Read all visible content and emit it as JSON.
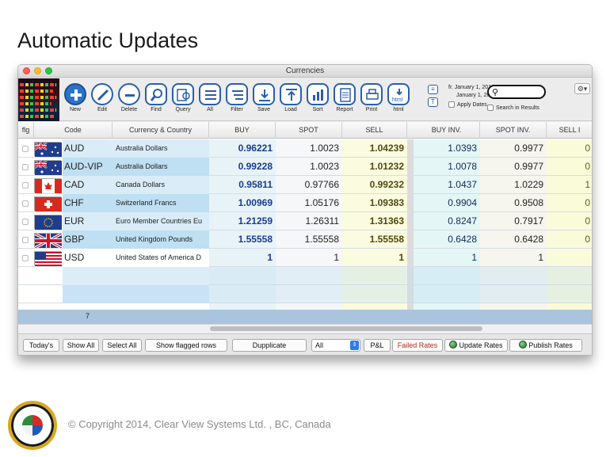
{
  "slide": {
    "title": "Automatic Updates",
    "copyright": "© Copyright 2014, Clear View Systems Ltd. , BC, Canada"
  },
  "window": {
    "title": "Currencies"
  },
  "toolbar": {
    "buttons": [
      {
        "label": "New",
        "icon": "plus-icon"
      },
      {
        "label": "Edit",
        "icon": "pencil-icon"
      },
      {
        "label": "Delete",
        "icon": "minus-icon"
      },
      {
        "label": "Find",
        "icon": "magnifier-icon"
      },
      {
        "label": "Query",
        "icon": "query-icon"
      },
      {
        "label": "All",
        "icon": "list-icon"
      },
      {
        "label": "Filter",
        "icon": "filter-list-icon"
      },
      {
        "label": "Save",
        "icon": "save-icon"
      },
      {
        "label": "Load",
        "icon": "load-icon"
      },
      {
        "label": "Sort",
        "icon": "sort-icon"
      },
      {
        "label": "Report",
        "icon": "report-icon"
      },
      {
        "label": "Print",
        "icon": "printer-icon"
      },
      {
        "label": "html",
        "icon": "html-export-icon"
      }
    ],
    "date_from": "fr.  January 1, 2012",
    "date_to": "January 1, 2013",
    "apply_dates": "Apply Dates",
    "search_in_results": "Search in Results",
    "search_placeholder": ""
  },
  "table": {
    "headers": [
      "flg",
      "Code",
      "Currency & Country",
      "BUY",
      "SPOT",
      "SELL",
      "BUY INV.",
      "SPOT INV.",
      "SELL I"
    ],
    "rows": [
      {
        "code": "AUD",
        "name": "Australia Dollars",
        "buy": "0.96221",
        "spot": "1.0023",
        "sell": "1.04239",
        "buy_inv": "1.0393",
        "spot_inv": "0.9977",
        "sell_inv": "0",
        "flag": "australia"
      },
      {
        "code": "AUD-VIP",
        "name": "Australia Dollars",
        "buy": "0.99228",
        "spot": "1.0023",
        "sell": "1.01232",
        "buy_inv": "1.0078",
        "spot_inv": "0.9977",
        "sell_inv": "0",
        "flag": "australia"
      },
      {
        "code": "CAD",
        "name": "Canada Dollars",
        "buy": "0.95811",
        "spot": "0.97766",
        "sell": "0.99232",
        "buy_inv": "1.0437",
        "spot_inv": "1.0229",
        "sell_inv": "1",
        "flag": "canada"
      },
      {
        "code": "CHF",
        "name": "Switzerland Francs",
        "buy": "1.00969",
        "spot": "1.05176",
        "sell": "1.09383",
        "buy_inv": "0.9904",
        "spot_inv": "0.9508",
        "sell_inv": "0",
        "flag": "switzerland"
      },
      {
        "code": "EUR",
        "name": "Euro Member Countries  Eu",
        "buy": "1.21259",
        "spot": "1.26311",
        "sell": "1.31363",
        "buy_inv": "0.8247",
        "spot_inv": "0.7917",
        "sell_inv": "0",
        "flag": "eu"
      },
      {
        "code": "GBP",
        "name": "United Kingdom Pounds",
        "buy": "1.55558",
        "spot": "1.55558",
        "sell": "1.55558",
        "buy_inv": "0.6428",
        "spot_inv": "0.6428",
        "sell_inv": "0",
        "flag": "uk"
      },
      {
        "code": "USD",
        "name": "United States of America D",
        "buy": "1",
        "spot": "1",
        "sell": "1",
        "buy_inv": "1",
        "spot_inv": "1",
        "sell_inv": "",
        "flag": "usa"
      }
    ],
    "record_count": "7"
  },
  "bottombar": {
    "todays": "Today's",
    "show_all": "Show All",
    "select_all": "Select All",
    "show_flagged": "Show flagged rows",
    "duplicate": "Dupplicate",
    "filter_select": "All",
    "pnl": "P&L",
    "failed_rates": "Failed Rates",
    "update_rates": "Update Rates",
    "publish_rates": "Publish Rates"
  },
  "colors": {
    "accent": "#2b5fa6",
    "buy_col_bg": "#e8f3f8",
    "spot_col_bg": "#f5f7f8",
    "sell_col_bg": "#fbfbdf",
    "buyinv_col_bg": "#e4f6f6",
    "spotinv_col_bg": "#f6f6ef",
    "sellinv_col_bg": "#fafbd9",
    "row_blue": "#bfdff2"
  }
}
